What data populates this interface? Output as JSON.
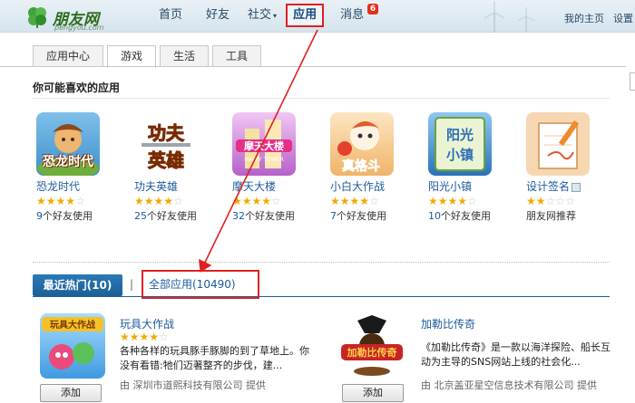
{
  "header": {
    "logo_text": "朋友网",
    "logo_sub": "pengyou.com",
    "nav": [
      {
        "label": "首页",
        "active": false
      },
      {
        "label": "好友",
        "active": false
      },
      {
        "label": "社交",
        "active": false,
        "caret": "▾"
      },
      {
        "label": "应用",
        "active": true
      },
      {
        "label": "消息",
        "active": false,
        "badge": "6"
      }
    ],
    "right_links": [
      "我的主页",
      "设置"
    ]
  },
  "tabs": [
    "应用中心",
    "游戏",
    "生活",
    "工具"
  ],
  "active_tab": "游戏",
  "section_title": "你可能喜欢的应用",
  "apps": [
    {
      "name": "恐龙时代",
      "stars": 4,
      "friends_num": "9",
      "friends_text": "个好友使用",
      "icon": "dinosaur-game-icon",
      "glyph": "恐龙时代",
      "color": "#6aa9d8"
    },
    {
      "name": "功夫英雄",
      "stars": 4,
      "friends_num": "25",
      "friends_text": "个好友使用",
      "icon": "kungfu-hero-icon",
      "glyph": "功夫英雄",
      "color": "#ffffff"
    },
    {
      "name": "摩天大楼",
      "stars": 4,
      "friends_num": "32",
      "friends_text": "个好友使用",
      "icon": "skyscraper-icon",
      "glyph": "摩天大楼",
      "color": "#c86ad6"
    },
    {
      "name": "小白大作战",
      "stars": 4,
      "friends_num": "7",
      "friends_text": "个好友使用",
      "icon": "xiaobai-battle-icon",
      "glyph": "真格斗",
      "color": "#f2c27a"
    },
    {
      "name": "阳光小镇",
      "stars": 4,
      "friends_num": "10",
      "friends_text": "个好友使用",
      "icon": "sunshine-town-icon",
      "glyph": "阳光小镇",
      "color": "#3a82c4"
    },
    {
      "name": "设计签名",
      "stars": 2,
      "friends_num": "",
      "friends_text": "朋友网推荐",
      "icon": "signature-design-icon",
      "glyph": "",
      "color": "#f4d9b8"
    }
  ],
  "hot_tab": "最近热门(10)",
  "separator": "|",
  "all_tab": "全部应用(10490)",
  "hot_apps": [
    {
      "name": "玩具大作战",
      "stars": 4,
      "desc": "各种各样的玩具豚手豚脚的到了草地上。你没有看错:牠们迈著整齐的步伐，建...",
      "provider": "由 深圳市道熙科技有限公司 提供",
      "add_label": "添加",
      "icon": "toy-battle-icon",
      "glyph": "玩具大作战"
    },
    {
      "name": "加勒比传奇",
      "stars": 0,
      "desc": "《加勒比传奇》是一款以海洋探险、船长互动为主导的SNS网站上线的社会化...",
      "provider": "由 北京盖亚星空信息技术有限公司 提供",
      "add_label": "添加",
      "icon": "caribbean-legend-icon",
      "glyph": "加勒比传奇"
    }
  ],
  "colors": {
    "accent": "#1c5a9e",
    "annotation": "#e02020",
    "star": "#f2a900"
  }
}
